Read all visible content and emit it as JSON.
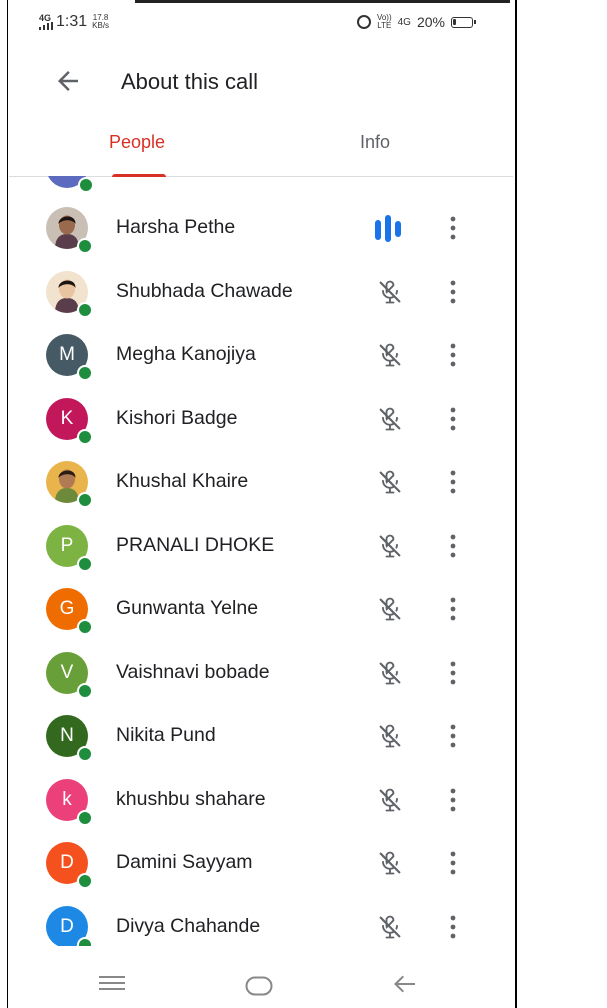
{
  "status_bar": {
    "network": "4G",
    "time": "1:31",
    "speed_value": "17.8",
    "speed_unit": "KB/s",
    "volte": "Vo))",
    "lte": "LTE",
    "data_type": "4G",
    "battery": "20%",
    "battery_level": 0.2
  },
  "header": {
    "title": "About this call"
  },
  "tabs": [
    {
      "label": "People",
      "active": true,
      "color": "#d93025"
    },
    {
      "label": "Info",
      "active": false
    }
  ],
  "participants": [
    {
      "name": "Harsha Pethe",
      "initial": "",
      "avatar": "photo-woman",
      "color": "#6d4c41",
      "status": "speaking"
    },
    {
      "name": "Shubhada Chawade",
      "initial": "",
      "avatar": "photo-woman-light",
      "color": "#c8a27a",
      "status": "muted"
    },
    {
      "name": "Megha Kanojiya",
      "initial": "M",
      "avatar": "letter",
      "color": "#455a64",
      "status": "muted"
    },
    {
      "name": "Kishori Badge",
      "initial": "K",
      "avatar": "letter",
      "color": "#c2185b",
      "status": "muted"
    },
    {
      "name": "Khushal Khaire",
      "initial": "",
      "avatar": "photo-man",
      "color": "#e0a33a",
      "status": "muted"
    },
    {
      "name": "PRANALI DHOKE",
      "initial": "P",
      "avatar": "letter",
      "color": "#7cb342",
      "status": "muted"
    },
    {
      "name": "Gunwanta Yelne",
      "initial": "G",
      "avatar": "letter",
      "color": "#ef6c00",
      "status": "muted"
    },
    {
      "name": "Vaishnavi bobade",
      "initial": "V",
      "avatar": "letter",
      "color": "#689f38",
      "status": "muted"
    },
    {
      "name": "Nikita Pund",
      "initial": "N",
      "avatar": "letter",
      "color": "#33691e",
      "status": "muted"
    },
    {
      "name": "khushbu shahare",
      "initial": "k",
      "avatar": "letter",
      "color": "#ec407a",
      "status": "muted"
    },
    {
      "name": "Damini Sayyam",
      "initial": "D",
      "avatar": "letter",
      "color": "#f4511e",
      "status": "muted"
    },
    {
      "name": "Divya Chahande",
      "initial": "D",
      "avatar": "letter",
      "color": "#1e88e5",
      "status": "muted"
    }
  ],
  "colors": {
    "accent": "#d93025",
    "online": "#1e8e3e",
    "speaking": "#1a73e8",
    "icon": "#5f6368"
  },
  "nav_icons": [
    "menu-icon",
    "home-icon",
    "back-icon"
  ]
}
